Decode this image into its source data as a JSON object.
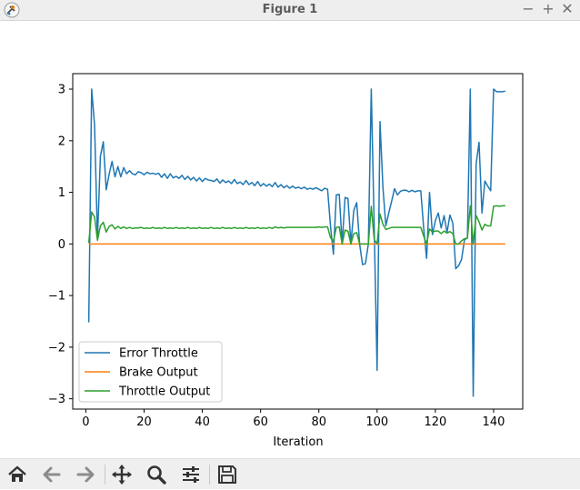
{
  "window": {
    "title": "Figure 1"
  },
  "window_buttons": {
    "minimize": "−",
    "maximize": "+",
    "close": "✕"
  },
  "toolbar": {
    "icons": [
      "home-icon",
      "back-arrow-icon",
      "forward-arrow-icon",
      "pan-icon",
      "zoom-icon",
      "configure-subplots-icon",
      "save-icon"
    ]
  },
  "chart_data": {
    "type": "line",
    "title": "",
    "xlabel": "Iteration",
    "ylabel": "",
    "xlim": [
      -4.5,
      150
    ],
    "ylim": [
      -3.2,
      3.3
    ],
    "xticks": [
      0,
      20,
      40,
      60,
      80,
      100,
      120,
      140
    ],
    "yticks": [
      -3,
      -2,
      -1,
      0,
      1,
      2,
      3
    ],
    "ytick_labels": [
      "−3",
      "−2",
      "−1",
      "0",
      "1",
      "2",
      "3"
    ],
    "grid": false,
    "legend_position": "lower-left",
    "x": [
      1,
      2,
      3,
      4,
      5,
      6,
      7,
      8,
      9,
      10,
      11,
      12,
      13,
      14,
      15,
      16,
      17,
      18,
      19,
      20,
      21,
      22,
      23,
      24,
      25,
      26,
      27,
      28,
      29,
      30,
      31,
      32,
      33,
      34,
      35,
      36,
      37,
      38,
      39,
      40,
      41,
      42,
      43,
      44,
      45,
      46,
      47,
      48,
      49,
      50,
      51,
      52,
      53,
      54,
      55,
      56,
      57,
      58,
      59,
      60,
      61,
      62,
      63,
      64,
      65,
      66,
      67,
      68,
      69,
      70,
      71,
      72,
      73,
      74,
      75,
      76,
      77,
      78,
      79,
      80,
      81,
      82,
      83,
      84,
      85,
      86,
      87,
      88,
      89,
      90,
      91,
      92,
      93,
      94,
      95,
      96,
      97,
      98,
      99,
      100,
      101,
      102,
      103,
      104,
      105,
      106,
      107,
      108,
      109,
      110,
      111,
      112,
      113,
      114,
      115,
      116,
      117,
      118,
      119,
      120,
      121,
      122,
      123,
      124,
      125,
      126,
      127,
      128,
      129,
      130,
      131,
      132,
      133,
      134,
      135,
      136,
      137,
      138,
      139,
      140,
      141,
      142,
      143,
      144
    ],
    "series": [
      {
        "name": "Error Throttle",
        "color": "#1f77b4",
        "values": [
          -1.52,
          3.0,
          2.3,
          0.1,
          1.7,
          1.98,
          1.05,
          1.35,
          1.6,
          1.3,
          1.5,
          1.3,
          1.48,
          1.36,
          1.42,
          1.36,
          1.34,
          1.4,
          1.38,
          1.34,
          1.39,
          1.36,
          1.37,
          1.35,
          1.37,
          1.29,
          1.36,
          1.27,
          1.36,
          1.28,
          1.31,
          1.27,
          1.33,
          1.25,
          1.31,
          1.24,
          1.29,
          1.22,
          1.28,
          1.21,
          1.27,
          1.24,
          1.23,
          1.21,
          1.26,
          1.18,
          1.24,
          1.19,
          1.22,
          1.17,
          1.25,
          1.17,
          1.2,
          1.15,
          1.23,
          1.15,
          1.19,
          1.13,
          1.21,
          1.12,
          1.17,
          1.12,
          1.16,
          1.11,
          1.19,
          1.1,
          1.15,
          1.09,
          1.13,
          1.08,
          1.12,
          1.08,
          1.1,
          1.07,
          1.1,
          1.06,
          1.08,
          1.06,
          1.09,
          1.06,
          1.03,
          1.08,
          1.06,
          0.35,
          -0.2,
          0.95,
          0.96,
          0.0,
          0.9,
          0.88,
          0.0,
          0.65,
          0.8,
          0.0,
          -0.4,
          -0.38,
          0.0,
          3.0,
          0.35,
          -2.45,
          2.37,
          1.1,
          0.35,
          0.6,
          0.83,
          1.07,
          0.95,
          1.02,
          1.04,
          1.04,
          1.01,
          1.04,
          1.01,
          1.03,
          1.03,
          0.3,
          -0.28,
          1.0,
          0.18,
          0.45,
          0.6,
          0.31,
          0.55,
          0.22,
          0.56,
          0.4,
          -0.48,
          -0.42,
          -0.3,
          0.08,
          0.12,
          3.0,
          -2.95,
          1.55,
          1.97,
          0.6,
          1.22,
          1.12,
          1.03,
          3.0,
          2.95,
          2.95,
          2.95,
          2.96
        ]
      },
      {
        "name": "Brake Output",
        "color": "#ff7f0e",
        "values": [
          0.0,
          0.0,
          0.0,
          0.0,
          0.0,
          0.0,
          0.0,
          0.0,
          0.0,
          0.0,
          0.0,
          0.0,
          0.0,
          0.0,
          0.0,
          0.0,
          0.0,
          0.0,
          0.0,
          0.0,
          0.0,
          0.0,
          0.0,
          0.0,
          0.0,
          0.0,
          0.0,
          0.0,
          0.0,
          0.0,
          0.0,
          0.0,
          0.0,
          0.0,
          0.0,
          0.0,
          0.0,
          0.0,
          0.0,
          0.0,
          0.0,
          0.0,
          0.0,
          0.0,
          0.0,
          0.0,
          0.0,
          0.0,
          0.0,
          0.0,
          0.0,
          0.0,
          0.0,
          0.0,
          0.0,
          0.0,
          0.0,
          0.0,
          0.0,
          0.0,
          0.0,
          0.0,
          0.0,
          0.0,
          0.0,
          0.0,
          0.0,
          0.0,
          0.0,
          0.0,
          0.0,
          0.0,
          0.0,
          0.0,
          0.0,
          0.0,
          0.0,
          0.0,
          0.0,
          0.0,
          0.0,
          0.0,
          0.0,
          0.0,
          0.0,
          0.0,
          0.0,
          0.0,
          0.0,
          0.0,
          0.0,
          0.0,
          0.0,
          0.0,
          0.0,
          0.0,
          0.0,
          0.0,
          0.0,
          0.0,
          0.0,
          0.0,
          0.0,
          0.0,
          0.0,
          0.0,
          0.0,
          0.0,
          0.0,
          0.0,
          0.0,
          0.0,
          0.0,
          0.0,
          0.0,
          0.0,
          0.0,
          0.0,
          0.0,
          0.0,
          0.0,
          0.0,
          0.0,
          0.0,
          0.0,
          0.0,
          0.0,
          0.0,
          0.0,
          0.0,
          0.0,
          0.0,
          0.0,
          0.0,
          0.0,
          0.0,
          0.0,
          0.0,
          0.0,
          0.0,
          0.0,
          0.0,
          0.0,
          0.0
        ]
      },
      {
        "name": "Throttle Output",
        "color": "#2ca02c",
        "values": [
          0.02,
          0.62,
          0.52,
          0.07,
          0.35,
          0.42,
          0.23,
          0.34,
          0.37,
          0.29,
          0.34,
          0.3,
          0.33,
          0.3,
          0.32,
          0.3,
          0.31,
          0.31,
          0.32,
          0.3,
          0.31,
          0.3,
          0.32,
          0.3,
          0.31,
          0.3,
          0.32,
          0.3,
          0.31,
          0.3,
          0.32,
          0.3,
          0.31,
          0.3,
          0.32,
          0.3,
          0.31,
          0.3,
          0.32,
          0.3,
          0.31,
          0.3,
          0.32,
          0.3,
          0.31,
          0.3,
          0.32,
          0.3,
          0.31,
          0.3,
          0.32,
          0.3,
          0.31,
          0.3,
          0.32,
          0.3,
          0.31,
          0.3,
          0.32,
          0.3,
          0.31,
          0.3,
          0.32,
          0.3,
          0.33,
          0.31,
          0.32,
          0.31,
          0.32,
          0.32,
          0.32,
          0.32,
          0.32,
          0.32,
          0.32,
          0.32,
          0.32,
          0.32,
          0.32,
          0.33,
          0.32,
          0.33,
          0.33,
          0.12,
          0.05,
          0.32,
          0.33,
          0.0,
          0.27,
          0.25,
          0.0,
          0.2,
          0.22,
          0.0,
          0.0,
          0.0,
          0.0,
          0.73,
          0.09,
          0.0,
          0.58,
          0.38,
          0.28,
          0.3,
          0.32,
          0.32,
          0.32,
          0.32,
          0.32,
          0.32,
          0.32,
          0.32,
          0.32,
          0.32,
          0.32,
          0.15,
          0.0,
          0.29,
          0.23,
          0.25,
          0.25,
          0.2,
          0.25,
          0.21,
          0.24,
          0.2,
          0.0,
          0.0,
          0.06,
          0.1,
          0.11,
          0.74,
          0.0,
          0.55,
          0.43,
          0.27,
          0.38,
          0.35,
          0.35,
          0.73,
          0.74,
          0.73,
          0.74,
          0.74
        ]
      }
    ]
  }
}
